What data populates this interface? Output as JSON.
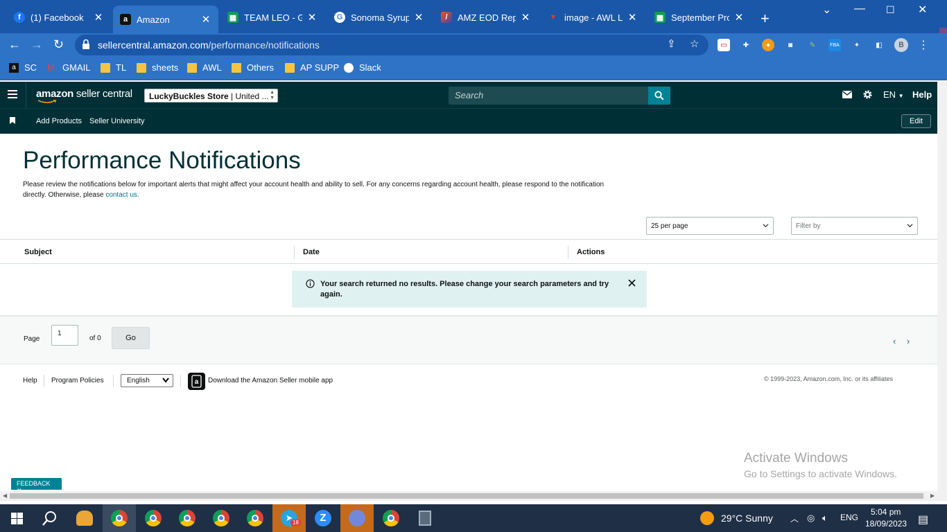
{
  "browser": {
    "tabs": [
      {
        "title": "(1) Facebook",
        "icon": "facebook-icon",
        "active": false
      },
      {
        "title": "Amazon",
        "icon": "amazon-icon",
        "active": true
      },
      {
        "title": "TEAM LEO - Goo",
        "icon": "sheets-icon",
        "active": false
      },
      {
        "title": "Sonoma Syrup Co",
        "icon": "google-icon",
        "active": false
      },
      {
        "title": "AMZ EOD Report",
        "icon": "report-icon",
        "active": false
      },
      {
        "title": "image - AWL LAB",
        "icon": "awl-icon",
        "active": false
      },
      {
        "title": "September Profit",
        "icon": "sheets-icon",
        "active": false
      }
    ],
    "url_host": "sellercentral.amazon.com",
    "url_path": "/performance/notifications",
    "profile_initial": "B",
    "bookmarks": [
      "SC",
      "GMAIL",
      "TL",
      "sheets",
      "AWL",
      "Others",
      "AP SUPP",
      "Slack"
    ]
  },
  "header": {
    "logo_main": "amazon",
    "logo_suffix": " seller central",
    "store_name": "LuckyBuckles Store",
    "store_region": " | United ...",
    "search_placeholder": "Search",
    "language": "EN",
    "help": "Help"
  },
  "subnav": {
    "links": [
      "Add Products",
      "Seller University"
    ],
    "edit": "Edit"
  },
  "page": {
    "title": "Performance Notifications",
    "description": "Please review the notifications below for important alerts that might affect your account health and ability to sell. For any concerns regarding account health, please respond to the notification directly. Otherwise, please ",
    "contact_link": "contact us.",
    "per_page": "25 per page",
    "filter_placeholder": "Filter by",
    "columns": [
      "Subject",
      "Date",
      "Actions"
    ],
    "alert_message": "Your search returned no results. Please change your search parameters and try again.",
    "pager": {
      "page_label": "Page",
      "page_value": "1",
      "of_label": "of 0",
      "go": "Go"
    }
  },
  "footer": {
    "help": "Help",
    "program_policies": "Program Policies",
    "language": "English",
    "app_text": "Download the Amazon Seller mobile app",
    "copyright": "© 1999-2023, Amazon.com, Inc. or its affiliates"
  },
  "watermark": {
    "line1": "Activate Windows",
    "line2": "Go to Settings to activate Windows."
  },
  "feedback": "FEEDBACK",
  "taskbar": {
    "weather": "29°C  Sunny",
    "lang": "ENG",
    "time": "5:04 pm",
    "date": "18/09/2023",
    "telegram_badge": "18"
  },
  "colors": {
    "tab_bg": "#1b57a8",
    "toolbar_bg": "#2e73c6",
    "sc_header": "#002f36",
    "teal": "#008296",
    "alert_bg": "#dff1f1"
  }
}
